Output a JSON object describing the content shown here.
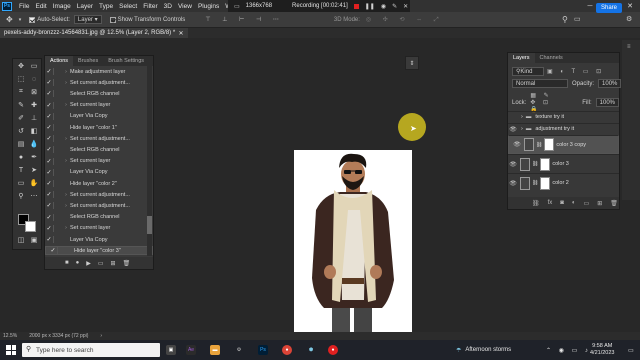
{
  "menubar": {
    "items": [
      "File",
      "Edit",
      "Image",
      "Layer",
      "Type",
      "Select",
      "Filter",
      "3D",
      "View",
      "Plugins",
      "Windo"
    ],
    "resolution": "1366x768",
    "recording": "Recording [00:02:41]"
  },
  "options_bar": {
    "auto_select_label": "Auto-Select:",
    "auto_select_value": "Layer",
    "show_transform_label": "Show Transform Controls",
    "mode_label": "3D Mode:",
    "share_label": "Share"
  },
  "document": {
    "tab_title": "pexels-addy-bronzzz-14564831.jpg @ 12.5% (Layer 2, RGB/8) *"
  },
  "actions_panel": {
    "tabs": [
      "Actions",
      "Brushes",
      "Brush Settings"
    ],
    "items": [
      {
        "label": "Make adjustment layer",
        "expand": true
      },
      {
        "label": "Set current adjustment...",
        "expand": true
      },
      {
        "label": "Select RGB channel",
        "expand": false
      },
      {
        "label": "Set current layer",
        "expand": true
      },
      {
        "label": "Layer Via Copy",
        "expand": false
      },
      {
        "label": "Hide layer \"color 1\"",
        "expand": false
      },
      {
        "label": "Set current adjustment...",
        "expand": true
      },
      {
        "label": "Select RGB channel",
        "expand": false
      },
      {
        "label": "Set current layer",
        "expand": true
      },
      {
        "label": "Layer Via Copy",
        "expand": false
      },
      {
        "label": "Hide layer \"color 2\"",
        "expand": false
      },
      {
        "label": "Set current adjustment...",
        "expand": true
      },
      {
        "label": "Set current adjustment...",
        "expand": true
      },
      {
        "label": "Select RGB channel",
        "expand": false
      },
      {
        "label": "Set current layer",
        "expand": true
      },
      {
        "label": "Layer Via Copy",
        "expand": false
      },
      {
        "label": "Hide layer \"color 3\"",
        "expand": false
      }
    ]
  },
  "layers_panel": {
    "tabs": [
      "Layers",
      "Channels"
    ],
    "kind_label": "Kind",
    "blend_mode": "Normal",
    "opacity_label": "Opacity:",
    "opacity_value": "100%",
    "lock_label": "Lock:",
    "fill_label": "Fill:",
    "fill_value": "100%",
    "layers": [
      {
        "name": "texture try it",
        "type": "folder",
        "visible": false
      },
      {
        "name": "adjustment try it",
        "type": "folder",
        "visible": true
      },
      {
        "name": "color 3 copy",
        "type": "adjustment",
        "visible": true
      },
      {
        "name": "color 3",
        "type": "adjustment",
        "visible": true
      },
      {
        "name": "color 2",
        "type": "adjustment",
        "visible": true
      }
    ]
  },
  "status_bar": {
    "zoom": "12.5%",
    "doc_size": "2000 px x 3334 px (72 ppi)"
  },
  "taskbar": {
    "search_placeholder": "Type here to search",
    "weather": "Afternoon storms",
    "time": "9:58 AM",
    "date": "4/21/2023"
  },
  "colors": {
    "accent": "#1473e6",
    "ps_blue": "#31a8ff",
    "record": "#e02020",
    "cursor_highlight": "#e6d21e"
  }
}
